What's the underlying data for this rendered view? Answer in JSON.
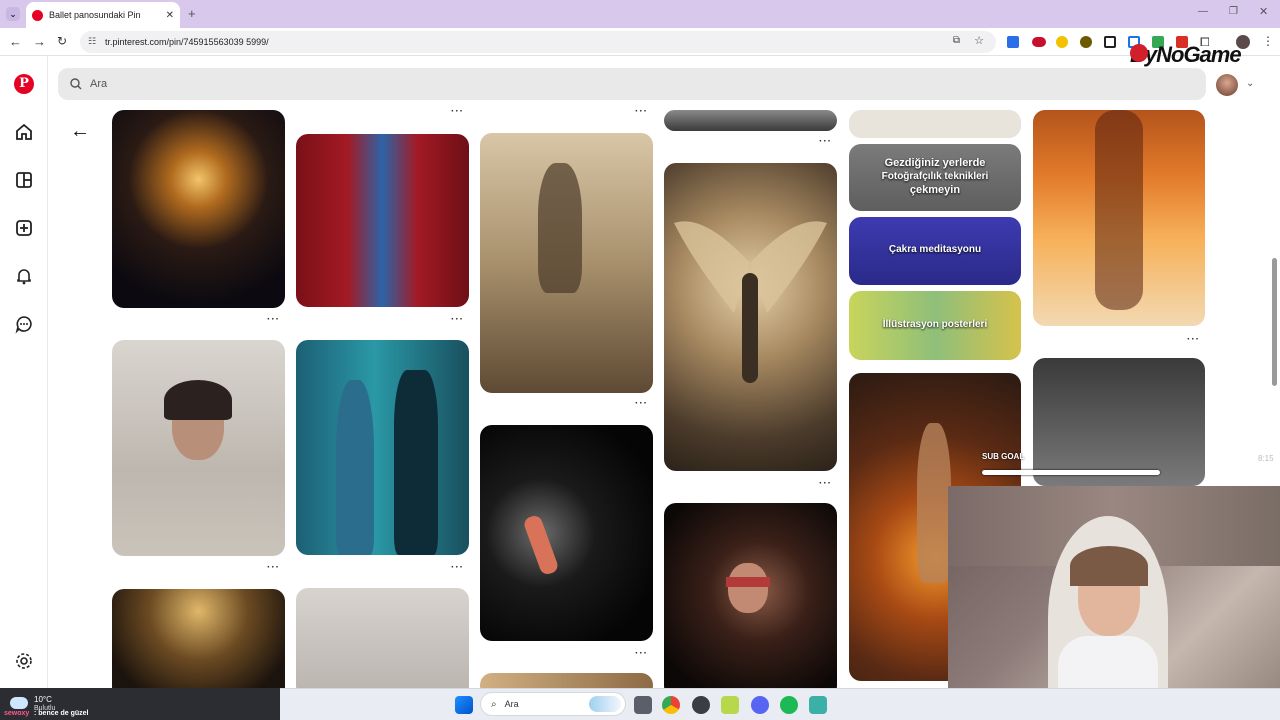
{
  "browser": {
    "tab_title": "Ballet panosundaki Pin",
    "url": "tr.pinterest.com/pin/745915563039 5999/"
  },
  "search": {
    "placeholder": "Ara"
  },
  "pins": {
    "text_1a": "Gezdiğiniz yerlerde",
    "text_1b": "Fotoğrafçılık teknikleri",
    "text_1c": "çekmeyin",
    "text_2": "Çakra meditasyonu",
    "text_3": "İllüstrasyon posterleri"
  },
  "overlay": {
    "logo": "ByNoGame",
    "sub_goal": "SUB GOAL",
    "weather_temp": "10°C",
    "weather_desc": "Bulutlu",
    "chat_user": "sewoxy",
    "chat_msg": ": bence de güzel",
    "clock": "8:15"
  },
  "taskbar": {
    "search_label": "Ara"
  },
  "colors": {
    "pinterest_red": "#e60023",
    "tab_bar": "#d8c8ec"
  }
}
